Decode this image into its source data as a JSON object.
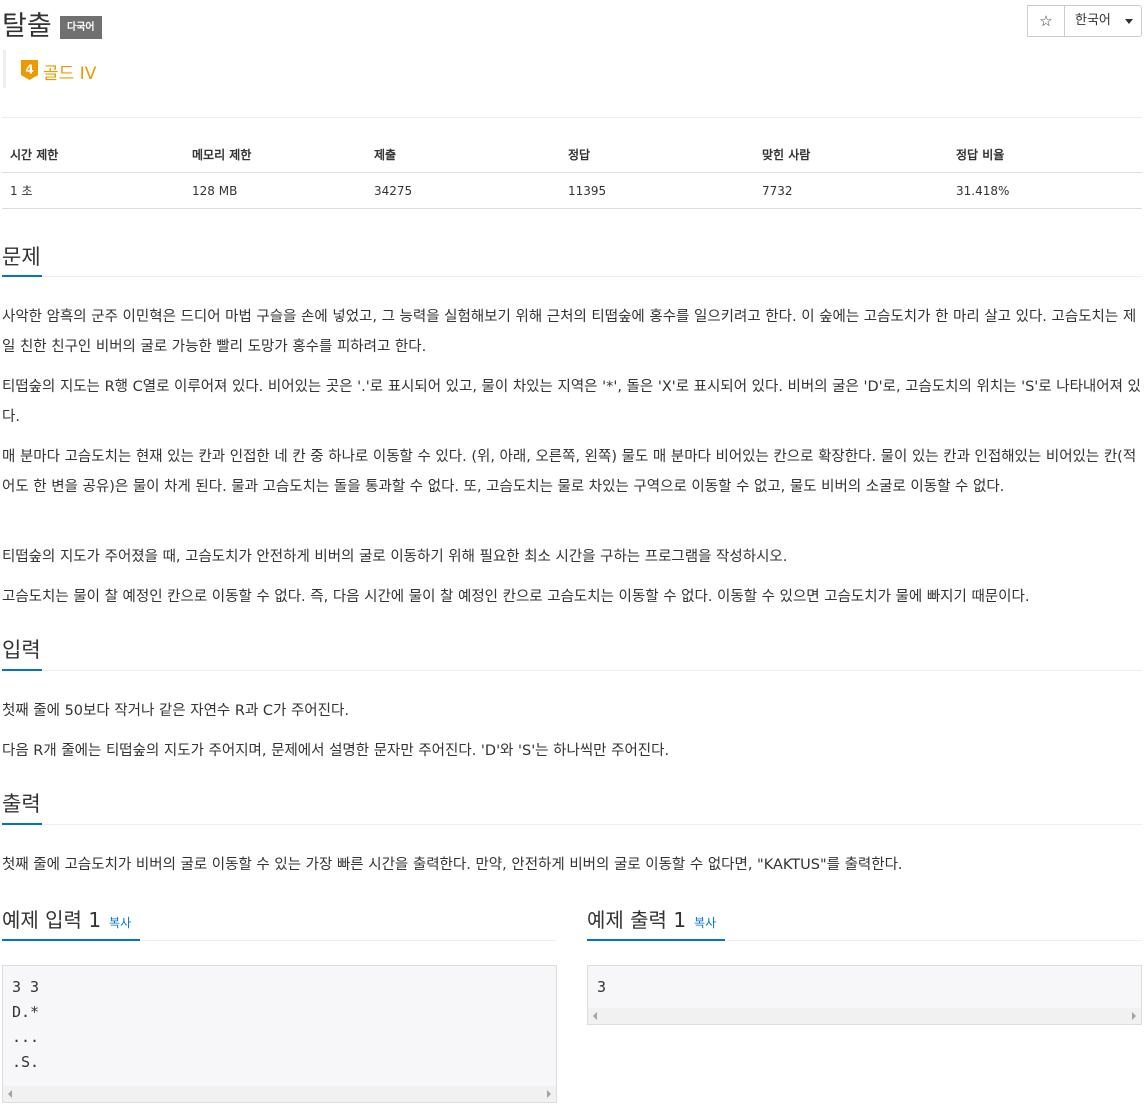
{
  "problem": {
    "title": "탈출",
    "language_badge": "다국어",
    "tier": "골드 IV",
    "tier_level": "4"
  },
  "toolbar": {
    "star_label": "☆",
    "language": "한국어"
  },
  "info_table": {
    "headers": [
      "시간 제한",
      "메모리 제한",
      "제출",
      "정답",
      "맞힌 사람",
      "정답 비율"
    ],
    "values": [
      "1 초",
      "128 MB",
      "34275",
      "11395",
      "7732",
      "31.418%"
    ]
  },
  "sections": {
    "problem_title": "문제",
    "problem_paragraphs": [
      "사악한 암흑의 군주 이민혁은 드디어 마법 구슬을 손에 넣었고, 그 능력을 실험해보기 위해 근처의 티떱숲에 홍수를 일으키려고 한다. 이 숲에는 고슴도치가 한 마리 살고 있다. 고슴도치는 제일 친한 친구인 비버의 굴로 가능한 빨리 도망가 홍수를 피하려고 한다.",
      "티떱숲의 지도는 R행 C열로 이루어져 있다. 비어있는 곳은 '.'로 표시되어 있고, 물이 차있는 지역은 '*', 돌은 'X'로 표시되어 있다. 비버의 굴은 'D'로, 고슴도치의 위치는 'S'로 나타내어져 있다.",
      "매 분마다 고슴도치는 현재 있는 칸과 인접한 네 칸 중 하나로 이동할 수 있다. (위, 아래, 오른쪽, 왼쪽) 물도 매 분마다 비어있는 칸으로 확장한다. 물이 있는 칸과 인접해있는 비어있는 칸(적어도 한 변을 공유)은 물이 차게 된다. 물과 고슴도치는 돌을 통과할 수 없다. 또, 고슴도치는 물로 차있는 구역으로 이동할 수 없고, 물도 비버의 소굴로 이동할 수 없다.",
      "티떱숲의 지도가 주어졌을 때, 고슴도치가 안전하게 비버의 굴로 이동하기 위해 필요한 최소 시간을 구하는 프로그램을 작성하시오.",
      "고슴도치는 물이 찰 예정인 칸으로 이동할 수 없다. 즉, 다음 시간에 물이 찰 예정인 칸으로 고슴도치는 이동할 수 없다. 이동할 수 있으면 고슴도치가 물에 빠지기 때문이다."
    ],
    "input_title": "입력",
    "input_paragraphs": [
      "첫째 줄에 50보다 작거나 같은 자연수 R과 C가 주어진다.",
      "다음 R개 줄에는 티떱숲의 지도가 주어지며, 문제에서 설명한 문자만 주어진다. 'D'와 'S'는 하나씩만 주어진다."
    ],
    "output_title": "출력",
    "output_paragraphs": [
      "첫째 줄에 고슴도치가 비버의 굴로 이동할 수 있는 가장 빠른 시간을 출력한다. 만약, 안전하게 비버의 굴로 이동할 수 없다면, \"KAKTUS\"를 출력한다."
    ]
  },
  "samples": {
    "input_title": "예제 입력 1",
    "output_title": "예제 출력 1",
    "copy_label": "복사",
    "input_lines": [
      "3 3",
      "D.*",
      "...",
      ".S."
    ],
    "output_lines": [
      "3"
    ]
  },
  "colors": {
    "accent": "#0076c0",
    "tier_gold": "#ec9a00"
  }
}
